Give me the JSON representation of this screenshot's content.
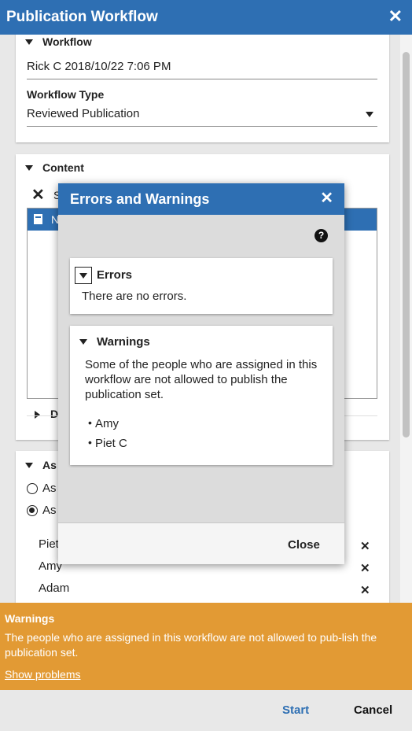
{
  "window": {
    "title": "Publication Workflow",
    "close_glyph": "✕"
  },
  "workflow_section": {
    "header": "Workflow",
    "name_value": "Rick C 2018/10/22 7:06 PM",
    "type_label": "Workflow Type",
    "type_value": "Reviewed Publication"
  },
  "content_section": {
    "header": "Content",
    "remove_glyph": "✕",
    "row_partial_label": "N",
    "toolbar_partial_label": "S",
    "details_partial_label": "D"
  },
  "assignment_section": {
    "header_partial": "As",
    "option1_partial": "As",
    "option2_partial": "As",
    "people": [
      "Piet",
      "Amy",
      "Adam"
    ],
    "remove_glyph": "✕"
  },
  "banner": {
    "title": "Warnings",
    "text": "The people who are assigned in this workflow are not allowed to pub-lish the publication set.",
    "link": "Show problems",
    "color": "#e29a34"
  },
  "footer": {
    "start_label": "Start",
    "cancel_label": "Cancel"
  },
  "dialog": {
    "title": "Errors and Warnings",
    "close_glyph": "✕",
    "help_glyph": "?",
    "errors": {
      "header": "Errors",
      "text": "There are no errors."
    },
    "warnings": {
      "header": "Warnings",
      "text": "Some of the people who are assigned in this workflow are not allowed to publish the publication set.",
      "people": [
        "Amy",
        "Piet C"
      ]
    },
    "close_label": "Close"
  },
  "colors": {
    "accent": "#2e6fb3",
    "banner": "#e29a34"
  }
}
